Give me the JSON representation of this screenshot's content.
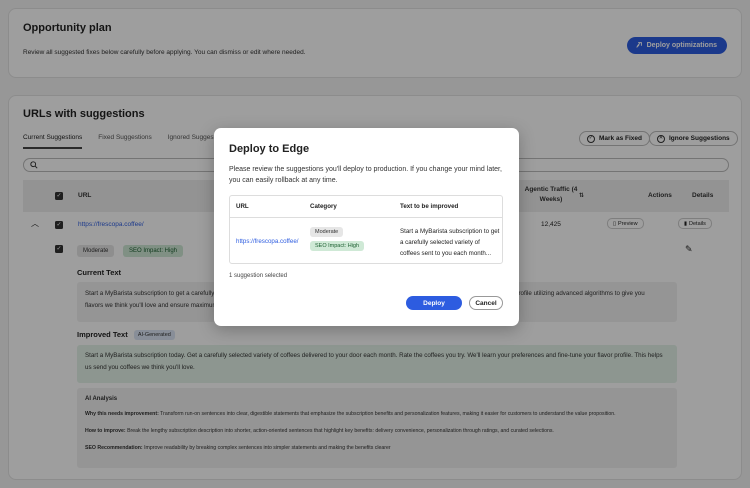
{
  "opportunity_plan": {
    "title": "Opportunity plan",
    "description": "Review all suggested fixes below carefully before applying. You can dismiss or edit where needed.",
    "deploy_optimizations_label": "Deploy optimizations"
  },
  "urls_section": {
    "title": "URLs with suggestions",
    "tabs": [
      "Current Suggestions",
      "Fixed Suggestions",
      "Ignored Suggestions"
    ],
    "active_tab": "Current Suggestions",
    "mark_as_fixed_label": "Mark as Fixed",
    "ignore_suggestions_label": "Ignore Suggestions",
    "search_placeholder": ""
  },
  "table": {
    "headers": {
      "url": "URL",
      "agentic_traffic": "Agentic Traffic (4 Weeks)",
      "actions": "Actions",
      "details": "Details"
    },
    "rows": [
      {
        "url": "https://frescopa.coffee/",
        "agentic_traffic": "12,425",
        "preview_label": "Preview",
        "details_label": "Details"
      }
    ]
  },
  "suggestion": {
    "category": "Moderate",
    "seo_impact": "SEO Impact: High",
    "current_text_label": "Current Text",
    "current_text_left": "Start a MyBarista subscription to get a carefully",
    "current_text_left_2": "flavors we think you'll love and ensure maximum",
    "current_text_right": "profile utilizing advanced algorithms to give you",
    "improved_text_label": "Improved Text",
    "ai_badge": "AI-Generated",
    "improved_text": "Start a MyBarista subscription today. Get a carefully selected variety of coffees delivered to your door each month. Rate the coffees you try. We'll learn your preferences and fine-tune your flavor profile. This helps us send you coffees we think you'll love.",
    "ai_analysis_title": "AI Analysis",
    "analysis": [
      {
        "label": "Why this needs improvement:",
        "text": "Transform run-on sentences into clear, digestible statements that emphasize the subscription benefits and personalization features, making it easier for customers to understand the value proposition."
      },
      {
        "label": "How to improve:",
        "text": "Break the lengthy subscription description into shorter, action-oriented sentences that highlight key benefits: delivery convenience, personalization through ratings, and curated selections."
      },
      {
        "label": "SEO Recommendation:",
        "text": "Improve readability by breaking complex sentences into simpler statements and making the benefits clearer"
      }
    ]
  },
  "modal": {
    "title": "Deploy to Edge",
    "description": "Please review the suggestions you'll deploy to production. If you change your mind later, you can easily rollback at any time.",
    "headers": {
      "url": "URL",
      "category": "Category",
      "text": "Text to be improved"
    },
    "row": {
      "url": "https://frescopa.coffee/",
      "category": "Moderate",
      "seo_impact": "SEO Impact: High",
      "text_line1": "Start a MyBarista subscription to get",
      "text_line2": "a carefully selected variety of",
      "text_line3": "coffees sent to you each month..."
    },
    "footer": "1 suggestion selected",
    "deploy_label": "Deploy",
    "cancel_label": "Cancel"
  },
  "colors": {
    "accent": "#2d5ce0",
    "seo_tag_bg": "#cfe9d6",
    "improved_bg": "#e4f3e8"
  }
}
